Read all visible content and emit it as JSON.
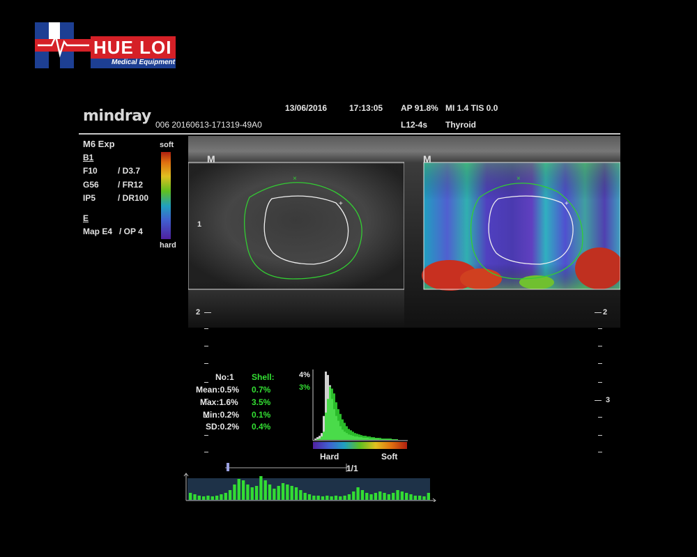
{
  "logo": {
    "brand_text": "HUE LOI",
    "sub_text": "Medical Equipment"
  },
  "header": {
    "brand": "mindray",
    "date": "13/06/2016",
    "time": "17:13:05",
    "ap": "AP 91.8%",
    "mi_tis": "MI 1.4 TIS 0.0",
    "exam_id": "006 20160613-171319-49A0",
    "probe": "L12-4s",
    "preset": "Thyroid"
  },
  "left_panel": {
    "mode": "M6 Exp",
    "b_label": "B1",
    "rows": [
      {
        "a": "F10",
        "b": "/ D3.7"
      },
      {
        "a": "G56",
        "b": "/ FR12"
      },
      {
        "a": "IP5",
        "b": "/ DR100"
      }
    ],
    "e_label": "E",
    "map": "Map E4",
    "op": "/ OP 4"
  },
  "colorbar": {
    "top_label": "soft",
    "bottom_label": "hard"
  },
  "depth_labels": {
    "d1": "1",
    "d2": "2",
    "d3": "3"
  },
  "marker_label": "M",
  "stats": {
    "headers": {
      "no": "No:1",
      "shell": "Shell:"
    },
    "rows": [
      {
        "label": "Mean:0.5%",
        "shell": "0.7%"
      },
      {
        "label": "Max:1.6%",
        "shell": "3.5%"
      },
      {
        "label": "Min:0.2%",
        "shell": "0.1%"
      },
      {
        "label": "SD:0.2%",
        "shell": "0.4%"
      }
    ]
  },
  "histogram": {
    "y_white": "4%",
    "y_green": "3%",
    "hard_label": "Hard",
    "soft_label": "Soft",
    "gray_bins": [
      2,
      4,
      6,
      10,
      35,
      100,
      95,
      80,
      60,
      45,
      35,
      28,
      20,
      15,
      12,
      10,
      8,
      7,
      6,
      5,
      5,
      4,
      4,
      3,
      3,
      3,
      2,
      2,
      2,
      2,
      2,
      1,
      1,
      1,
      1,
      1,
      1,
      1,
      1,
      1
    ],
    "green_bins": [
      0,
      1,
      2,
      5,
      12,
      40,
      60,
      78,
      75,
      68,
      55,
      45,
      38,
      30,
      25,
      20,
      16,
      14,
      12,
      10,
      9,
      8,
      7,
      6,
      6,
      5,
      5,
      4,
      4,
      3,
      3,
      3,
      2,
      2,
      2,
      2,
      2,
      1,
      1,
      1
    ]
  },
  "cine": {
    "frame": "1/1",
    "bars": [
      10,
      8,
      6,
      5,
      6,
      5,
      6,
      8,
      10,
      14,
      22,
      30,
      28,
      22,
      18,
      20,
      34,
      28,
      22,
      16,
      20,
      24,
      22,
      20,
      18,
      14,
      10,
      8,
      6,
      6,
      5,
      6,
      5,
      6,
      5,
      6,
      8,
      12,
      18,
      14,
      10,
      8,
      10,
      12,
      10,
      8,
      10,
      14,
      12,
      10,
      8,
      6,
      6,
      5,
      10
    ]
  }
}
